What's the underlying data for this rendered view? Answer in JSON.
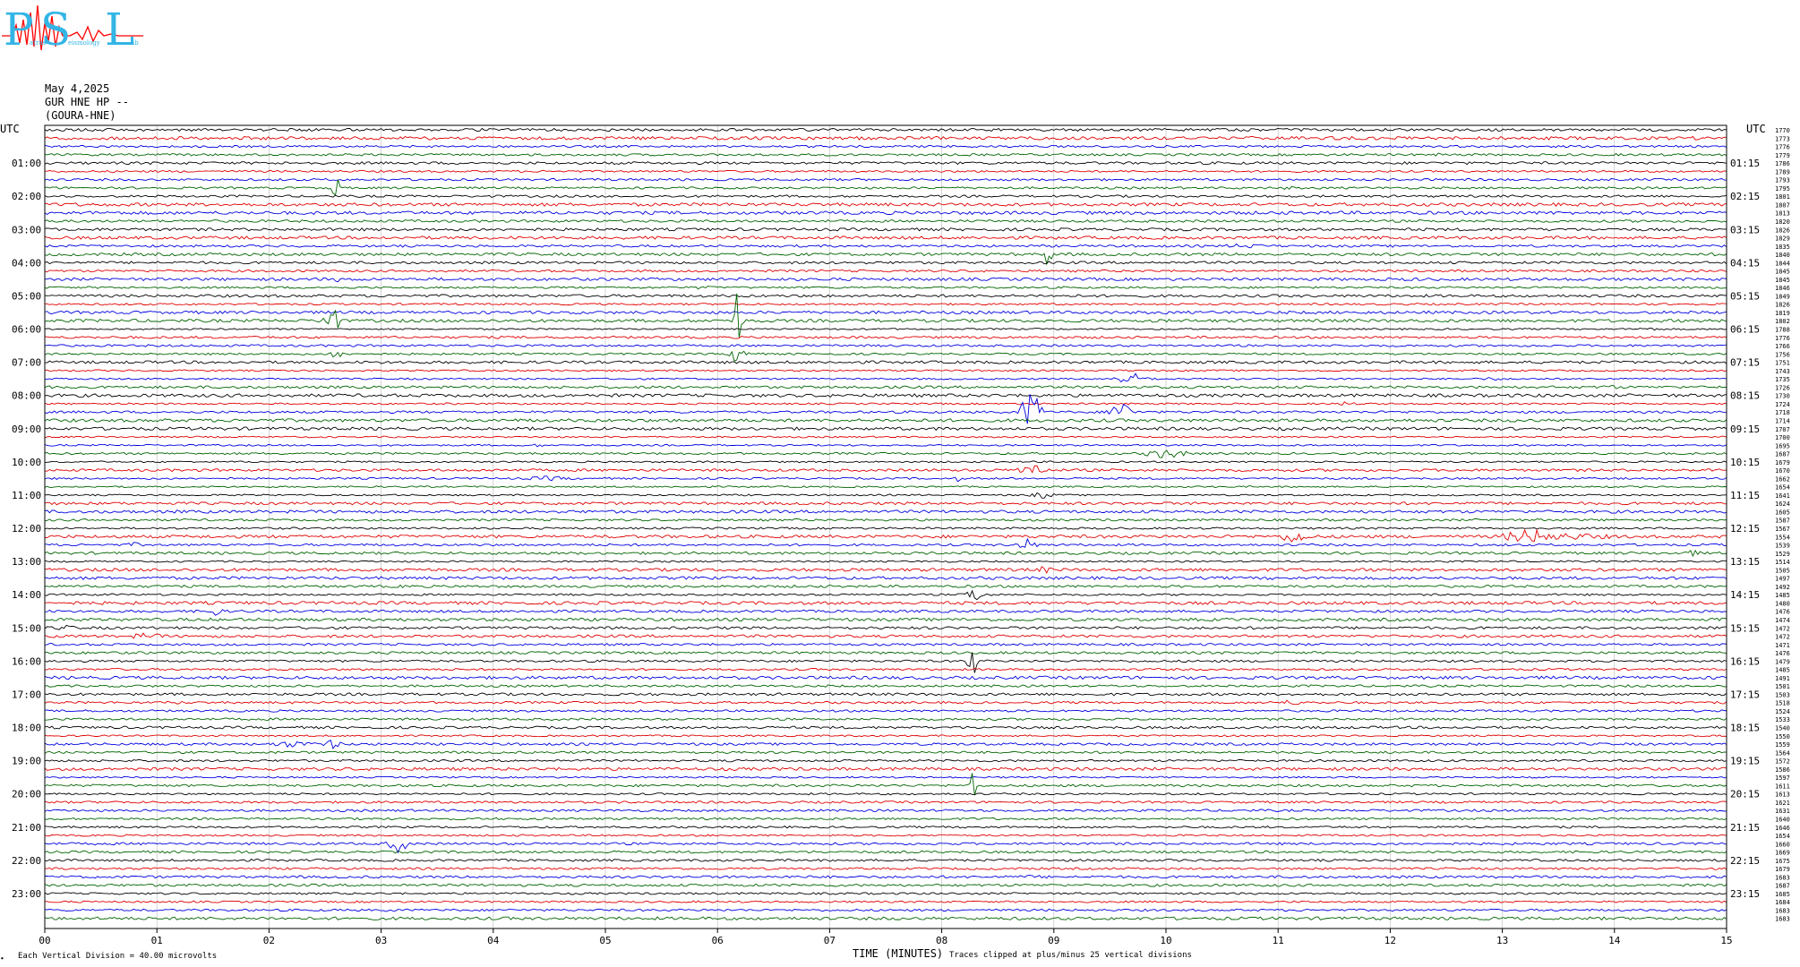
{
  "logo": {
    "big_letters": [
      "P",
      "S",
      "L"
    ],
    "small_parts": [
      "atras",
      "eismology",
      "ab"
    ]
  },
  "header": {
    "date": "May 4,2025",
    "station": "GUR HNE HP --",
    "site": "(GOURA-HNE)"
  },
  "left_axis_title": "UTC",
  "right_axis_title": "UTC",
  "footer": {
    "division_note": "Each Vertical Division =   40.00 microvolts",
    "x_title": "TIME (MINUTES)",
    "clip_note": "Traces clipped at plus/minus 25 vertical divisions",
    "corner_mark": "∙"
  },
  "colors": {
    "trace_cycle": [
      "#000000",
      "#e00000",
      "#0000e0",
      "#006400"
    ],
    "logo": "#33b5e5",
    "logo_trace": "#ff0000",
    "grid": "#808080"
  },
  "chart_data": {
    "type": "line",
    "x_range": [
      0,
      15
    ],
    "x_ticks": [
      "00",
      "01",
      "02",
      "03",
      "04",
      "05",
      "06",
      "07",
      "08",
      "09",
      "10",
      "11",
      "12",
      "13",
      "14",
      "15"
    ],
    "x_unit": "minutes",
    "trace_minutes": 15,
    "trace_count": 96,
    "left_hour_labels": [
      "01:00",
      "02:00",
      "03:00",
      "04:00",
      "05:00",
      "06:00",
      "07:00",
      "08:00",
      "09:00",
      "10:00",
      "11:00",
      "12:00",
      "13:00",
      "14:00",
      "15:00",
      "16:00",
      "17:00",
      "18:00",
      "19:00",
      "20:00",
      "21:00",
      "22:00",
      "23:00"
    ],
    "right_hour_labels": [
      "01:15",
      "02:15",
      "03:15",
      "04:15",
      "05:15",
      "06:15",
      "07:15",
      "08:15",
      "09:15",
      "10:15",
      "11:15",
      "12:15",
      "13:15",
      "14:15",
      "15:15",
      "16:15",
      "17:15",
      "18:15",
      "19:15",
      "20:15",
      "21:15",
      "22:15",
      "23:15"
    ],
    "right_values": [
      1770,
      1773,
      1776,
      1779,
      1786,
      1789,
      1793,
      1795,
      1801,
      1807,
      1813,
      1820,
      1826,
      1829,
      1835,
      1840,
      1844,
      1845,
      1845,
      1846,
      1849,
      1826,
      1819,
      1802,
      1788,
      1776,
      1766,
      1756,
      1751,
      1743,
      1735,
      1726,
      1730,
      1724,
      1718,
      1714,
      1707,
      1700,
      1695,
      1687,
      1679,
      1670,
      1662,
      1654,
      1641,
      1624,
      1605,
      1587,
      1567,
      1554,
      1539,
      1529,
      1514,
      1505,
      1497,
      1492,
      1485,
      1480,
      1476,
      1474,
      1472,
      1472,
      1471,
      1476,
      1479,
      1485,
      1491,
      1501,
      1503,
      1518,
      1524,
      1533,
      1540,
      1550,
      1559,
      1564,
      1572,
      1586,
      1597,
      1611,
      1613,
      1621,
      1631,
      1640,
      1646,
      1654,
      1660,
      1669,
      1675,
      1679,
      1683,
      1687,
      1685,
      1684,
      1683,
      1683
    ],
    "events": [
      {
        "trace": 1,
        "minute": 3.42,
        "width": 0.08,
        "amp": 2.5
      },
      {
        "trace": 1,
        "minute": 6.9,
        "width": 0.08,
        "amp": 2.5
      },
      {
        "trace": 3,
        "minute": 12.45,
        "width": 0.15,
        "amp": 2
      },
      {
        "trace": 7,
        "minute": 11.1,
        "width": 0.25,
        "amp": 2
      },
      {
        "trace": 7,
        "minute": 2.58,
        "width": 0.05,
        "amp": 42,
        "clip": [
          -10,
          5
        ]
      },
      {
        "trace": 14,
        "minute": 10.7,
        "width": 0.4,
        "amp": 3
      },
      {
        "trace": 15,
        "minute": 8.95,
        "width": 0.05,
        "amp": 18,
        "clip": [
          -3,
          10
        ]
      },
      {
        "trace": 18,
        "minute": 2.6,
        "width": 0.25,
        "amp": 3
      },
      {
        "trace": 18,
        "minute": 12.2,
        "width": 0.5,
        "amp": 2
      },
      {
        "trace": 19,
        "minute": 5.85,
        "width": 0.3,
        "amp": 2
      },
      {
        "trace": 23,
        "minute": 2.55,
        "width": 0.08,
        "amp": 42,
        "clip": [
          -11,
          8
        ]
      },
      {
        "trace": 23,
        "minute": 6.18,
        "width": 0.06,
        "amp": 42,
        "clip": [
          -11,
          2
        ]
      },
      {
        "trace": 24,
        "minute": 14.3,
        "width": 0.3,
        "amp": 2
      },
      {
        "trace": 27,
        "minute": 6.2,
        "width": 0.12,
        "amp": 14
      },
      {
        "trace": 27,
        "minute": 2.6,
        "width": 0.08,
        "amp": 10
      },
      {
        "trace": 30,
        "minute": 9.7,
        "width": 0.25,
        "amp": 7
      },
      {
        "trace": 30,
        "minute": 12.9,
        "width": 0.3,
        "amp": 2
      },
      {
        "trace": 31,
        "minute": 13.95,
        "width": 0.2,
        "amp": 3
      },
      {
        "trace": 33,
        "minute": 11.6,
        "width": 0.15,
        "amp": 3
      },
      {
        "trace": 34,
        "minute": 8.8,
        "width": 0.14,
        "amp": 26,
        "clip": [
          -3,
          8
        ]
      },
      {
        "trace": 34,
        "minute": 9.6,
        "width": 0.16,
        "amp": 14
      },
      {
        "trace": 38,
        "minute": 4.4,
        "width": 0.12,
        "amp": 2
      },
      {
        "trace": 39,
        "minute": 10.0,
        "width": 0.3,
        "amp": 6
      },
      {
        "trace": 41,
        "minute": 11.0,
        "width": 0.35,
        "amp": 2
      },
      {
        "trace": 41,
        "minute": 8.8,
        "width": 0.18,
        "amp": 10
      },
      {
        "trace": 42,
        "minute": 8.15,
        "width": 0.05,
        "amp": 4
      },
      {
        "trace": 42,
        "minute": 4.5,
        "width": 0.35,
        "amp": 3
      },
      {
        "trace": 44,
        "minute": 8.9,
        "width": 0.18,
        "amp": 4
      },
      {
        "trace": 45,
        "minute": 8.1,
        "width": 0.1,
        "amp": 2
      },
      {
        "trace": 45,
        "minute": 11.25,
        "width": 0.1,
        "amp": 2
      },
      {
        "trace": 49,
        "minute": 11.15,
        "width": 0.18,
        "amp": 9
      },
      {
        "trace": 49,
        "minute": 13.25,
        "width": 0.4,
        "amp": 9
      },
      {
        "trace": 49,
        "minute": 13.6,
        "width": 0.8,
        "amp": 4
      },
      {
        "trace": 50,
        "minute": 8.75,
        "width": 0.14,
        "amp": 8
      },
      {
        "trace": 50,
        "minute": 0.8,
        "width": 0.15,
        "amp": 3
      },
      {
        "trace": 51,
        "minute": 14.7,
        "width": 0.12,
        "amp": 4
      },
      {
        "trace": 53,
        "minute": 8.92,
        "width": 0.1,
        "amp": 5
      },
      {
        "trace": 55,
        "minute": 3.2,
        "width": 0.1,
        "amp": 3
      },
      {
        "trace": 56,
        "minute": 0.6,
        "width": 0.05,
        "amp": 2
      },
      {
        "trace": 56,
        "minute": 8.3,
        "width": 0.15,
        "amp": 9
      },
      {
        "trace": 58,
        "minute": 1.5,
        "width": 0.12,
        "amp": 7
      },
      {
        "trace": 59,
        "minute": 14.95,
        "width": 0.05,
        "amp": 3
      },
      {
        "trace": 60,
        "minute": 0.2,
        "width": 0.3,
        "amp": 3
      },
      {
        "trace": 61,
        "minute": 0.9,
        "width": 0.3,
        "amp": 4
      },
      {
        "trace": 64,
        "minute": 8.27,
        "width": 0.05,
        "amp": 38,
        "clip": [
          -10,
          3
        ]
      },
      {
        "trace": 66,
        "minute": 6.2,
        "width": 0.3,
        "amp": 2
      },
      {
        "trace": 69,
        "minute": 1.15,
        "width": 0.3,
        "amp": 2
      },
      {
        "trace": 69,
        "minute": 11.1,
        "width": 0.35,
        "amp": 3
      },
      {
        "trace": 71,
        "minute": 14.0,
        "width": 0.1,
        "amp": 2
      },
      {
        "trace": 74,
        "minute": 2.2,
        "width": 0.35,
        "amp": 4
      },
      {
        "trace": 74,
        "minute": 2.55,
        "width": 0.15,
        "amp": 6
      },
      {
        "trace": 79,
        "minute": 8.27,
        "width": 0.04,
        "amp": 38,
        "clip": [
          -16,
          14
        ]
      },
      {
        "trace": 86,
        "minute": 3.15,
        "width": 0.15,
        "amp": 10
      },
      {
        "trace": 90,
        "minute": 8.8,
        "width": 0.6,
        "amp": 2
      },
      {
        "trace": 90,
        "minute": 11.2,
        "width": 0.4,
        "amp": 2
      },
      {
        "trace": 94,
        "minute": 3.1,
        "width": 0.3,
        "amp": 2
      }
    ]
  }
}
